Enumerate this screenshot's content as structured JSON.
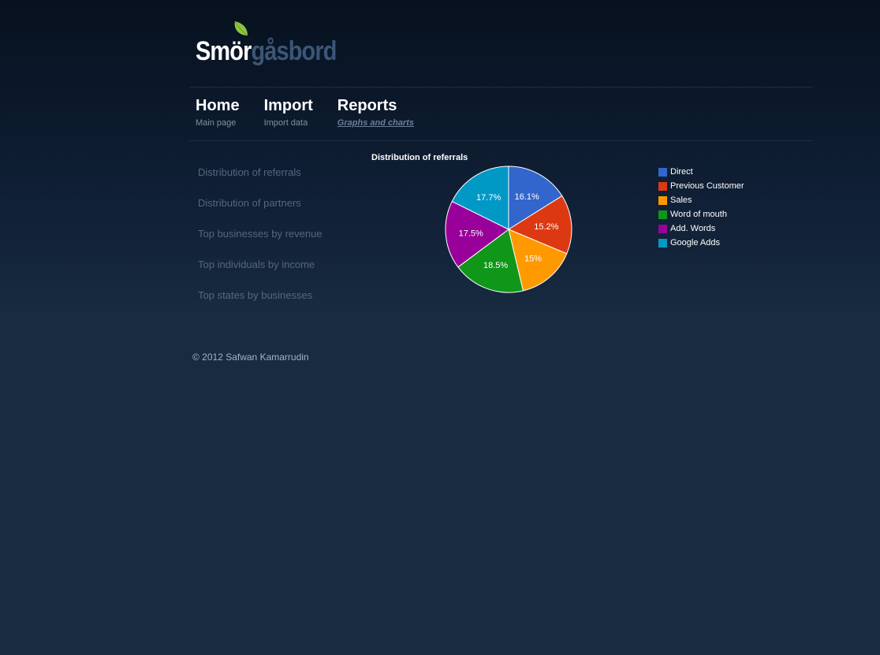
{
  "logo": {
    "part1": "Smör",
    "part2": "gåsbord",
    "icon": "leaf-icon",
    "leaf_color": "#8dc63f"
  },
  "nav": [
    {
      "title": "Home",
      "sub": "Main page",
      "active": false
    },
    {
      "title": "Import",
      "sub": "Import data",
      "active": false
    },
    {
      "title": "Reports",
      "sub": "Graphs and charts",
      "active": true
    }
  ],
  "sidebar": {
    "items": [
      {
        "label": "Distribution of referrals"
      },
      {
        "label": "Distribution of partners"
      },
      {
        "label": "Top businesses by revenue"
      },
      {
        "label": "Top individuals by income"
      },
      {
        "label": "Top states by businesses"
      }
    ]
  },
  "chart_data": {
    "type": "pie",
    "title": "Distribution of referrals",
    "categories": [
      "Direct",
      "Previous Customer",
      "Sales",
      "Word of mouth",
      "Add. Words",
      "Google Adds"
    ],
    "values": [
      16.1,
      15.2,
      15,
      18.5,
      17.5,
      17.7
    ],
    "labels": [
      "16.1%",
      "15.2%",
      "15%",
      "18.5%",
      "17.5%",
      "17.7%"
    ],
    "colors": [
      "#3366cc",
      "#dc3912",
      "#ff9900",
      "#109618",
      "#990099",
      "#0099c6"
    ],
    "legend": "right"
  },
  "footer": {
    "text": "© 2012 Safwan Kamarrudin"
  }
}
